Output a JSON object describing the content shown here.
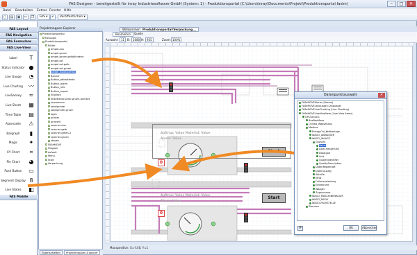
{
  "window": {
    "title": "FAS Designer - bereitgestellt für inray Industriesoftware GmbH (System: 1) - Produktionsportal (C:\\Users\\inray\\Documents\\Projekt\\Produktionsportal.fasim)",
    "min": "–",
    "max": "□",
    "close": "✕"
  },
  "menu": [
    "Datei",
    "Bearbeiten",
    "Extras",
    "Fenster",
    "Hilfe"
  ],
  "toolbar": {
    "fas_label": "FAS ▾",
    "publish_label": "Veröffentlichen ▾"
  },
  "palette": {
    "sections": [
      "FAS Layout",
      "FAS Navigation",
      "FAS Formulare",
      "FAS Live-View"
    ],
    "items": [
      {
        "label": "Label",
        "icon": "T"
      },
      {
        "label": "Status Indicator",
        "icon": "●"
      },
      {
        "label": "Live Gauge",
        "icon": "◔"
      },
      {
        "label": "Live Charting",
        "icon": "〰"
      },
      {
        "label": "LiveSankey",
        "icon": "≈"
      },
      {
        "label": "Live Sheet",
        "icon": "▦"
      },
      {
        "label": "Time Table",
        "icon": "▤"
      },
      {
        "label": "Alarmzeile",
        "icon": "⚠"
      },
      {
        "label": "Bargraph",
        "icon": "▮"
      },
      {
        "label": "Magic",
        "icon": "✦"
      },
      {
        "label": "XY Chart",
        "icon": "⌗"
      },
      {
        "label": "Pie Chart",
        "icon": "◕"
      },
      {
        "label": "Push Button",
        "icon": "▭"
      },
      {
        "label": "Segment Display",
        "icon": "8"
      },
      {
        "label": "Live States",
        "icon": "◧"
      }
    ],
    "footer": "FAS Mobile"
  },
  "explorer": {
    "title": "Projektmappen-Explorer",
    "tree": [
      {
        "d": 0,
        "t": "Produktionsportal"
      },
      {
        "d": 1,
        "t": "FASLogin"
      },
      {
        "d": 1,
        "t": "Produktionsportal"
      },
      {
        "d": 2,
        "t": "Bilder"
      },
      {
        "d": 3,
        "t": "ampel-aus"
      },
      {
        "d": 3,
        "t": "ampel-gruen"
      },
      {
        "d": 3,
        "t": "ampel-gruen-gelbblinkend"
      },
      {
        "d": 3,
        "t": "ampel-rot"
      },
      {
        "d": 3,
        "t": "ampel-rot-gelb"
      },
      {
        "d": 3,
        "t": "ampel-rot-gruen"
      },
      {
        "d": 3,
        "t": "badge_4Dokgum4G",
        "sel": true
      },
      {
        "d": 3,
        "t": "Banner"
      },
      {
        "d": 3,
        "t": "Button_abbalkieste"
      },
      {
        "d": 3,
        "t": "Button_alarm"
      },
      {
        "d": 3,
        "t": "Button_info"
      },
      {
        "d": 3,
        "t": "Button_report"
      },
      {
        "d": 3,
        "t": "Englisch"
      },
      {
        "d": 3,
        "t": "Etikettendrucker-gruen-anmket"
      },
      {
        "d": 3,
        "t": "impressum"
      },
      {
        "d": 3,
        "t": "labelprinter"
      },
      {
        "d": 3,
        "t": "labelprinter-gruen"
      },
      {
        "d": 3,
        "t": "login"
      },
      {
        "d": 3,
        "t": "printer"
      },
      {
        "d": 3,
        "t": "printer0"
      },
      {
        "d": 3,
        "t": "scanner-aus"
      },
      {
        "d": 3,
        "t": "scanner-gelb"
      },
      {
        "d": 3,
        "t": "scanner-green-2"
      },
      {
        "d": 3,
        "t": "scanner-gruen"
      },
      {
        "d": 3,
        "t": "stopes"
      },
      {
        "d": 2,
        "t": "FASeMOVE"
      },
      {
        "d": 2,
        "t": "Fleggen"
      },
      {
        "d": 2,
        "t": "default"
      },
      {
        "d": 2,
        "t": "Menu"
      },
      {
        "d": 2,
        "t": "Start"
      },
      {
        "d": 2,
        "t": "Verpackung"
      }
    ],
    "tabs": [
      "Eigenschaften",
      "Projektmappen-Explorer"
    ]
  },
  "document": {
    "tabs": [
      "Willkommen",
      "Produktionsportal\\Verpackung..."
    ],
    "subtabs": [
      "Bearbeiten",
      "Quelle"
    ],
    "auswahl_label": "Auswahl:",
    "auswahl_value": "11",
    "b_label": "B:",
    "b_value": "1680",
    "h_label": "H:",
    "h_value": "955",
    "zoom_label": "Zoom:",
    "zoom_value": "100%",
    "status": "Mausposition: X=-140; Y=1"
  },
  "canvas": {
    "order_text": "Auftrag: Value  Material: Value",
    "alarm_text": "Alarm: Value",
    "start_label": "Start",
    "counter": "0"
  },
  "dialog": {
    "title": "Datenpunktauswahl",
    "close": "✕",
    "tree": [
      {
        "d": 0,
        "t": "FASeMOVEAlarm (Alarme)"
      },
      {
        "d": 0,
        "t": "FASeMOVELanguage (Language)"
      },
      {
        "d": 0,
        "t": "FASeMOVELiveCharting (Live Charting)"
      },
      {
        "d": 0,
        "t": "FASeMOVELiveViewItem (Live View Items)"
      },
      {
        "d": 1,
        "t": "OPCServer1"
      },
      {
        "d": 2,
        "t": "BusBoxMove"
      },
      {
        "d": 2,
        "t": "Chinea_Waasehaus"
      },
      {
        "d": 2,
        "t": "Modbus"
      },
      {
        "d": 3,
        "t": "EnergyCal_Kedkanlage"
      },
      {
        "d": 3,
        "t": "WAGO_ABWASSER"
      },
      {
        "d": 3,
        "t": "WAGO_WAAGE"
      },
      {
        "d": 4,
        "t": "Gewicht"
      },
      {
        "d": 5,
        "t": "Value",
        "sel": true
      },
      {
        "d": 5,
        "t": "LastChange(Utc)"
      },
      {
        "d": 5,
        "t": "Datatype"
      },
      {
        "d": 5,
        "t": "Unit"
      },
      {
        "d": 5,
        "t": "QualityIdentifier"
      },
      {
        "d": 5,
        "t": "QualityDescription"
      },
      {
        "d": 4,
        "t": "DatenRegelkraft"
      },
      {
        "d": 4,
        "t": "DatenQuality"
      },
      {
        "d": 4,
        "t": "AktelFe"
      },
      {
        "d": 4,
        "t": "MHD"
      },
      {
        "d": 4,
        "t": "Fullenauslastung"
      },
      {
        "d": 4,
        "t": "Einkelknmt"
      },
      {
        "d": 4,
        "t": "Waagel"
      },
      {
        "d": 4,
        "t": "Zugnummer"
      },
      {
        "d": 3,
        "t": "WAGO_MASCHINENRAUM"
      },
      {
        "d": 3,
        "t": "WAGO_NSSIV"
      },
      {
        "d": 3,
        "t": "WAGO-PACKSTELLE"
      },
      {
        "d": 2,
        "t": "Siemens"
      }
    ],
    "ok": "OK",
    "cancel": "Abbrechen"
  },
  "colors": {
    "accent": "#3a6fd0",
    "arrow": "#f08a24",
    "pipe": "#c47bb8",
    "pipe_dark": "#9b4b8f"
  }
}
